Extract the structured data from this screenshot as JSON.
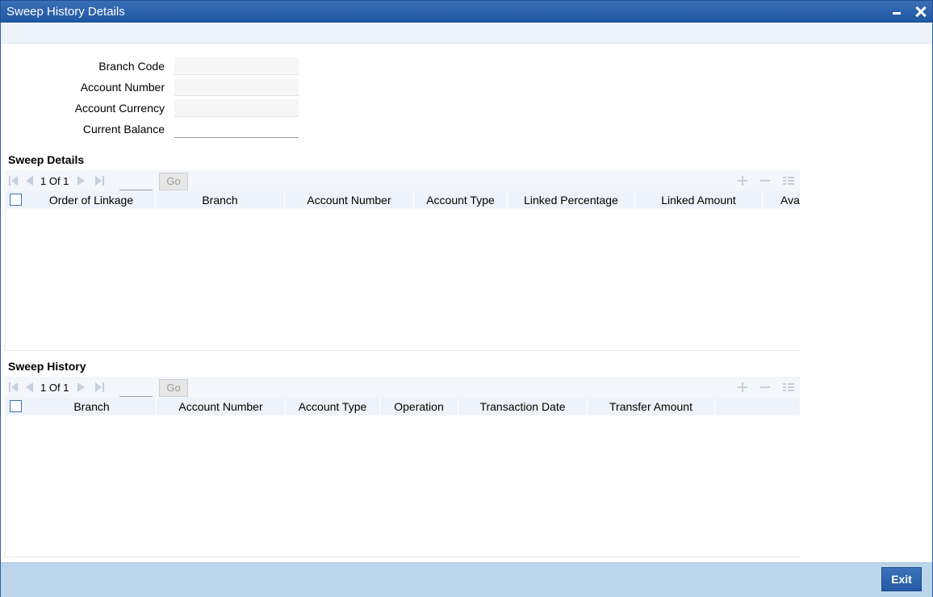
{
  "window": {
    "title": "Sweep History Details"
  },
  "form": {
    "branch_code_label": "Branch Code",
    "account_number_label": "Account Number",
    "account_currency_label": "Account Currency",
    "current_balance_label": "Current Balance",
    "branch_code_value": "",
    "account_number_value": "",
    "account_currency_value": "",
    "current_balance_value": ""
  },
  "sweep_details": {
    "title": "Sweep Details",
    "page_text": "1 Of 1",
    "go_label": "Go",
    "columns": [
      "Order of Linkage",
      "Branch",
      "Account Number",
      "Account Type",
      "Linked Percentage",
      "Linked Amount",
      "Avai"
    ]
  },
  "sweep_history": {
    "title": "Sweep History",
    "page_text": "1 Of 1",
    "go_label": "Go",
    "columns": [
      "Branch",
      "Account Number",
      "Account Type",
      "Operation",
      "Transaction Date",
      "Transfer Amount"
    ]
  },
  "footer": {
    "exit_label": "Exit"
  },
  "colors": {
    "title_bar": "#2a62ad",
    "footer": "#bcd5ea",
    "grid_header": "#eef3fb",
    "button": "#2e65ae"
  }
}
